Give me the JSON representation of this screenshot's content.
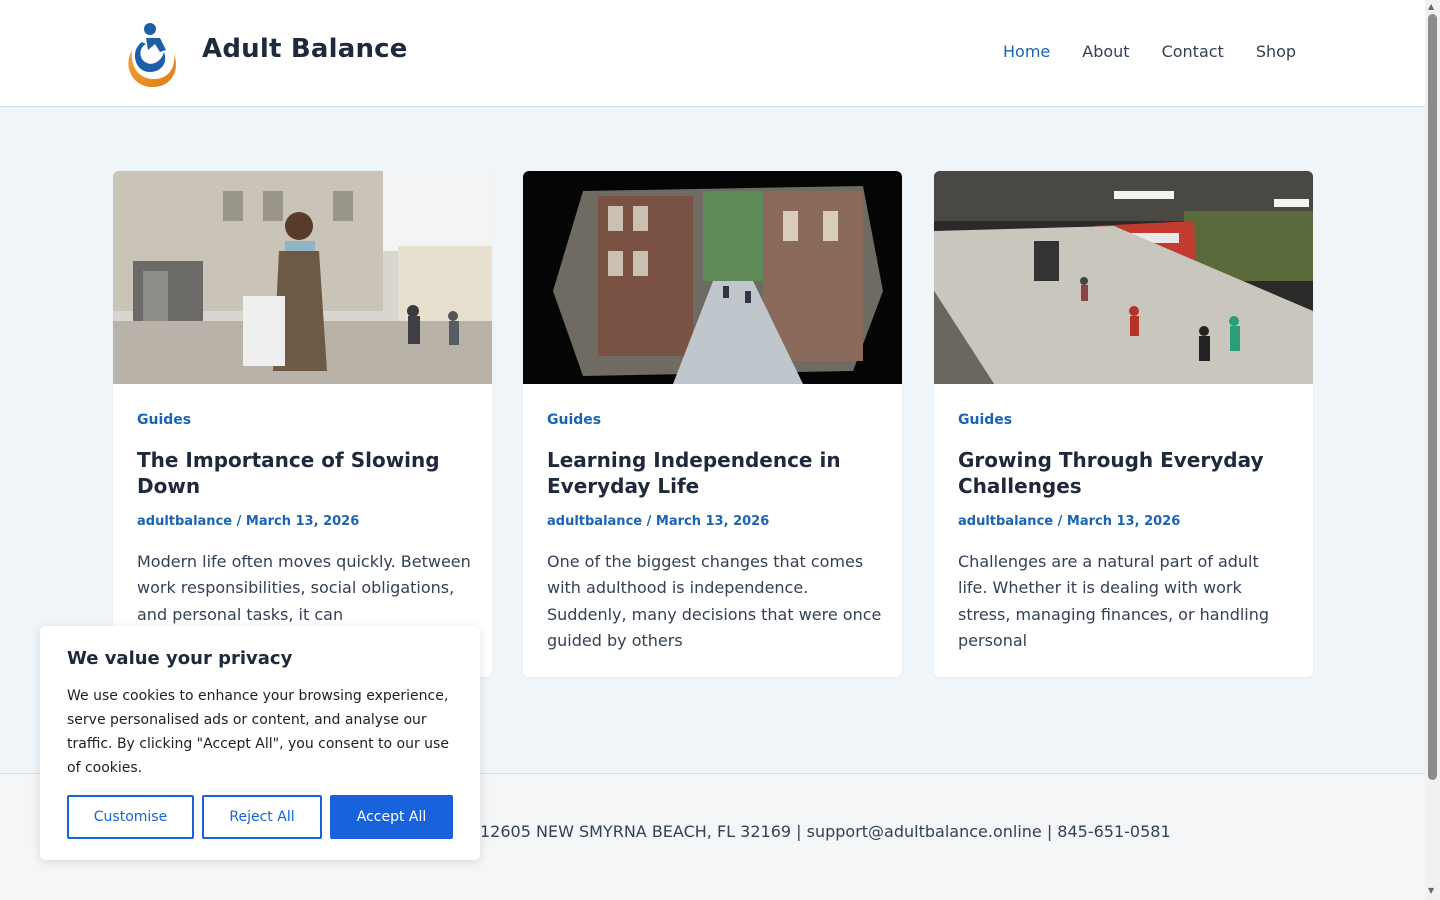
{
  "header": {
    "site_title": "Adult Balance",
    "logo_icon": "person-swirl-logo-icon",
    "nav": [
      {
        "label": "Home",
        "active": true
      },
      {
        "label": "About",
        "active": false
      },
      {
        "label": "Contact",
        "active": false
      },
      {
        "label": "Shop",
        "active": false
      }
    ]
  },
  "posts": [
    {
      "category": "Guides",
      "title": "The Importance of Slowing Down",
      "author": "adultbalance",
      "separator": "/",
      "date": "March 13, 2026",
      "excerpt": "Modern life often moves quickly. Between work responsibilities, social obligations, and personal tasks, it can"
    },
    {
      "category": "Guides",
      "title": "Learning Independence in Everyday Life",
      "author": "adultbalance",
      "separator": "/",
      "date": "March 13, 2026",
      "excerpt": "One of the biggest changes that comes with adulthood is independence. Suddenly, many decisions that were once guided by others"
    },
    {
      "category": "Guides",
      "title": "Growing Through Everyday Challenges",
      "author": "adultbalance",
      "separator": "/",
      "date": "March 13, 2026",
      "excerpt": "Challenges are a natural part of adult life. Whether it is dealing with work stress, managing finances, or handling personal"
    }
  ],
  "footer": {
    "text": "12605 NEW SMYRNA BEACH, FL 32169 | support@adultbalance.online | 845-651-0581"
  },
  "cookie_banner": {
    "title": "We value your privacy",
    "body": "We use cookies to enhance your browsing experience, serve personalised ads or content, and analyse our traffic. By clicking \"Accept All\", you consent to our use of cookies.",
    "customise_label": "Customise",
    "reject_label": "Reject All",
    "accept_label": "Accept All"
  },
  "colors": {
    "accent": "#1b64b5",
    "cookie_button": "#1863dc",
    "page_bg": "#f0f5fa"
  }
}
